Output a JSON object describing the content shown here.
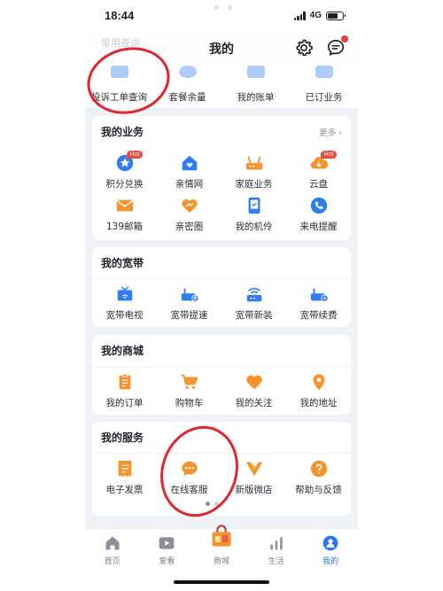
{
  "status_bar": {
    "time": "18:44",
    "network": "4G"
  },
  "header": {
    "title": "我的",
    "faded_section_title": "常用查询"
  },
  "quick_query": [
    {
      "label": "投诉工单查询",
      "icon": "complaint-icon",
      "color": "#4a8ff0"
    },
    {
      "label": "套餐余量",
      "icon": "pie-chart-icon",
      "color": "#4a8ff0"
    },
    {
      "label": "我的账单",
      "icon": "bill-icon",
      "color": "#4a8ff0"
    },
    {
      "label": "已订业务",
      "icon": "subscription-icon",
      "color": "#4a8ff0"
    }
  ],
  "my_business": {
    "title": "我的业务",
    "more_label": "更多",
    "items": [
      {
        "label": "积分兑换",
        "icon": "points-icon",
        "badge": "Hot"
      },
      {
        "label": "亲情网",
        "icon": "family-home-icon"
      },
      {
        "label": "家庭业务",
        "icon": "router-icon"
      },
      {
        "label": "云盘",
        "icon": "cloud-icon",
        "badge": "Hot"
      },
      {
        "label": "139邮箱",
        "icon": "mail-icon"
      },
      {
        "label": "亲密圈",
        "icon": "heart-circle-icon"
      },
      {
        "label": "我的机伶",
        "icon": "phone-icon"
      },
      {
        "label": "来电提醒",
        "icon": "call-icon"
      }
    ]
  },
  "my_broadband": {
    "title": "我的宽带",
    "items": [
      {
        "label": "宽带电视",
        "icon": "tv-icon"
      },
      {
        "label": "宽带提速",
        "icon": "modem-speed-icon"
      },
      {
        "label": "宽带新装",
        "icon": "wifi-router-icon"
      },
      {
        "label": "宽带续费",
        "icon": "modem-renew-icon"
      }
    ]
  },
  "my_mall": {
    "title": "我的商城",
    "items": [
      {
        "label": "我的订单",
        "icon": "order-icon"
      },
      {
        "label": "购物车",
        "icon": "cart-icon"
      },
      {
        "label": "我的关注",
        "icon": "heart-icon"
      },
      {
        "label": "我的地址",
        "icon": "location-pin-icon"
      }
    ]
  },
  "my_services": {
    "title": "我的服务",
    "items": [
      {
        "label": "电子发票",
        "icon": "invoice-icon"
      },
      {
        "label": "在线客服",
        "icon": "chat-bubble-icon"
      },
      {
        "label": "新版微店",
        "icon": "shop-logo-icon"
      },
      {
        "label": "帮助与反馈",
        "icon": "help-icon"
      }
    ]
  },
  "tab_bar": {
    "active": "我的",
    "items": [
      {
        "label": "首页",
        "icon": "home-icon"
      },
      {
        "label": "爱看",
        "icon": "play-icon"
      },
      {
        "label": "商城",
        "icon": "shopping-bag-icon"
      },
      {
        "label": "生活",
        "icon": "bars-icon"
      },
      {
        "label": "我的",
        "icon": "profile-icon"
      }
    ]
  },
  "colors": {
    "accent": "#2a74f5",
    "orange": "#f6932a",
    "hot_badge": "#f0473c",
    "annotation": "#e2262d"
  }
}
